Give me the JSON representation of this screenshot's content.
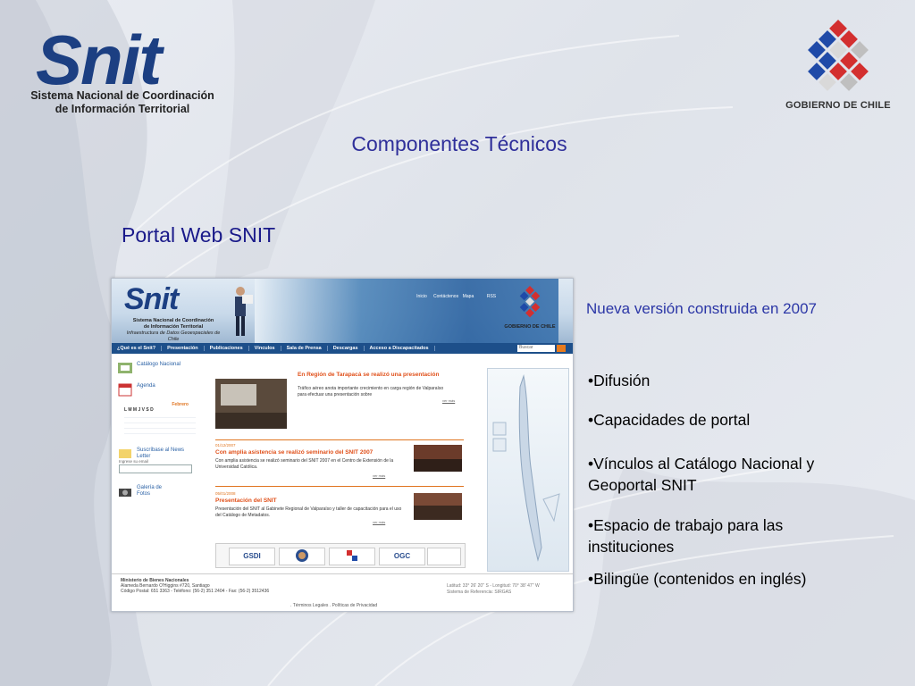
{
  "snit_logo": {
    "wordmark": "Snit",
    "subtitle_line1": "Sistema Nacional de Coordinación",
    "subtitle_line2": "de Información Territorial"
  },
  "gobierno_logo": {
    "caption": "GOBIERNO DE CHILE"
  },
  "slide": {
    "title": "Componentes Técnicos",
    "subtitle": "Portal Web SNIT",
    "highlight": "Nueva versión construida en 2007",
    "bullets": [
      "•Difusión",
      "•Capacidades de portal",
      "•Vínculos al Catálogo Nacional y Geoportal SNIT",
      "•Espacio de trabajo para las instituciones",
      "•Bilingüe (contenidos en inglés)"
    ]
  },
  "portal": {
    "logo": "Snit",
    "logo_sub1": "Sistema Nacional de Coordinación",
    "logo_sub2": "de Información Territorial",
    "logo_sub3": "Infraestructura de Datos Geoespaciales de Chile",
    "top_icons": [
      "Inicio",
      "Contáctenos",
      "Mapa",
      "RSS"
    ],
    "gob_caption": "GOBIERNO DE CHILE",
    "nav": [
      "¿Qué es el Snit?",
      "Presentación",
      "Publicaciones",
      "Vínculos",
      "Sala de Prensa",
      "Descargas",
      "Acceso a Discapacitados"
    ],
    "search_placeholder": "Buscar",
    "left": {
      "catalogo": "Catálogo Nacional",
      "agenda": "Agenda",
      "month": "Febrero",
      "weekdays": "L M M J V S D",
      "suscribase": "Suscríbase al News Letter",
      "email_label": "Ingrese su email",
      "galeria": "Galería de Fotos"
    },
    "news": [
      {
        "date": "",
        "title": "En Región de Tarapacá se realizó una presentación",
        "text": "Tráfico aéreo anota importante crecimiento en carga región de Valparaíso para efectuar una presentación sobre",
        "more": "ver más"
      },
      {
        "date": "01/12/2007",
        "title": "Con amplia asistencia se realizó seminario del SNIT 2007",
        "text": "Con amplia asistencia se realizó seminario del SNIT 2007 en el Centro de Extensión de la Universidad Católica.",
        "more": "ver más"
      },
      {
        "date": "05/01/2008",
        "title": "Presentación del SNIT",
        "text": "Presentación del SNIT al Gabinete Regional de Valparaíso y taller de capacitación para el uso del Catálogo de Metadatos.",
        "more": "ver más"
      }
    ],
    "banners": [
      "GSDI",
      "",
      "",
      "OGC",
      ""
    ],
    "footer": {
      "org": "Ministerio de Bienes Nacionales",
      "address": "Alameda Bernardo O'Higgins #720, Santiago",
      "phone": "Código Postal: 651 3363 - Teléfono: (56-2) 351 2404 - Fax: (56-2) 3512436",
      "coords": "Latitud: 33° 26' 20'' S - Longitud: 70° 38' 47'' W",
      "ref": "Sistema de Referencia: SIRGAS",
      "links": ". Términos Legales . Políticas de Privacidad"
    }
  }
}
